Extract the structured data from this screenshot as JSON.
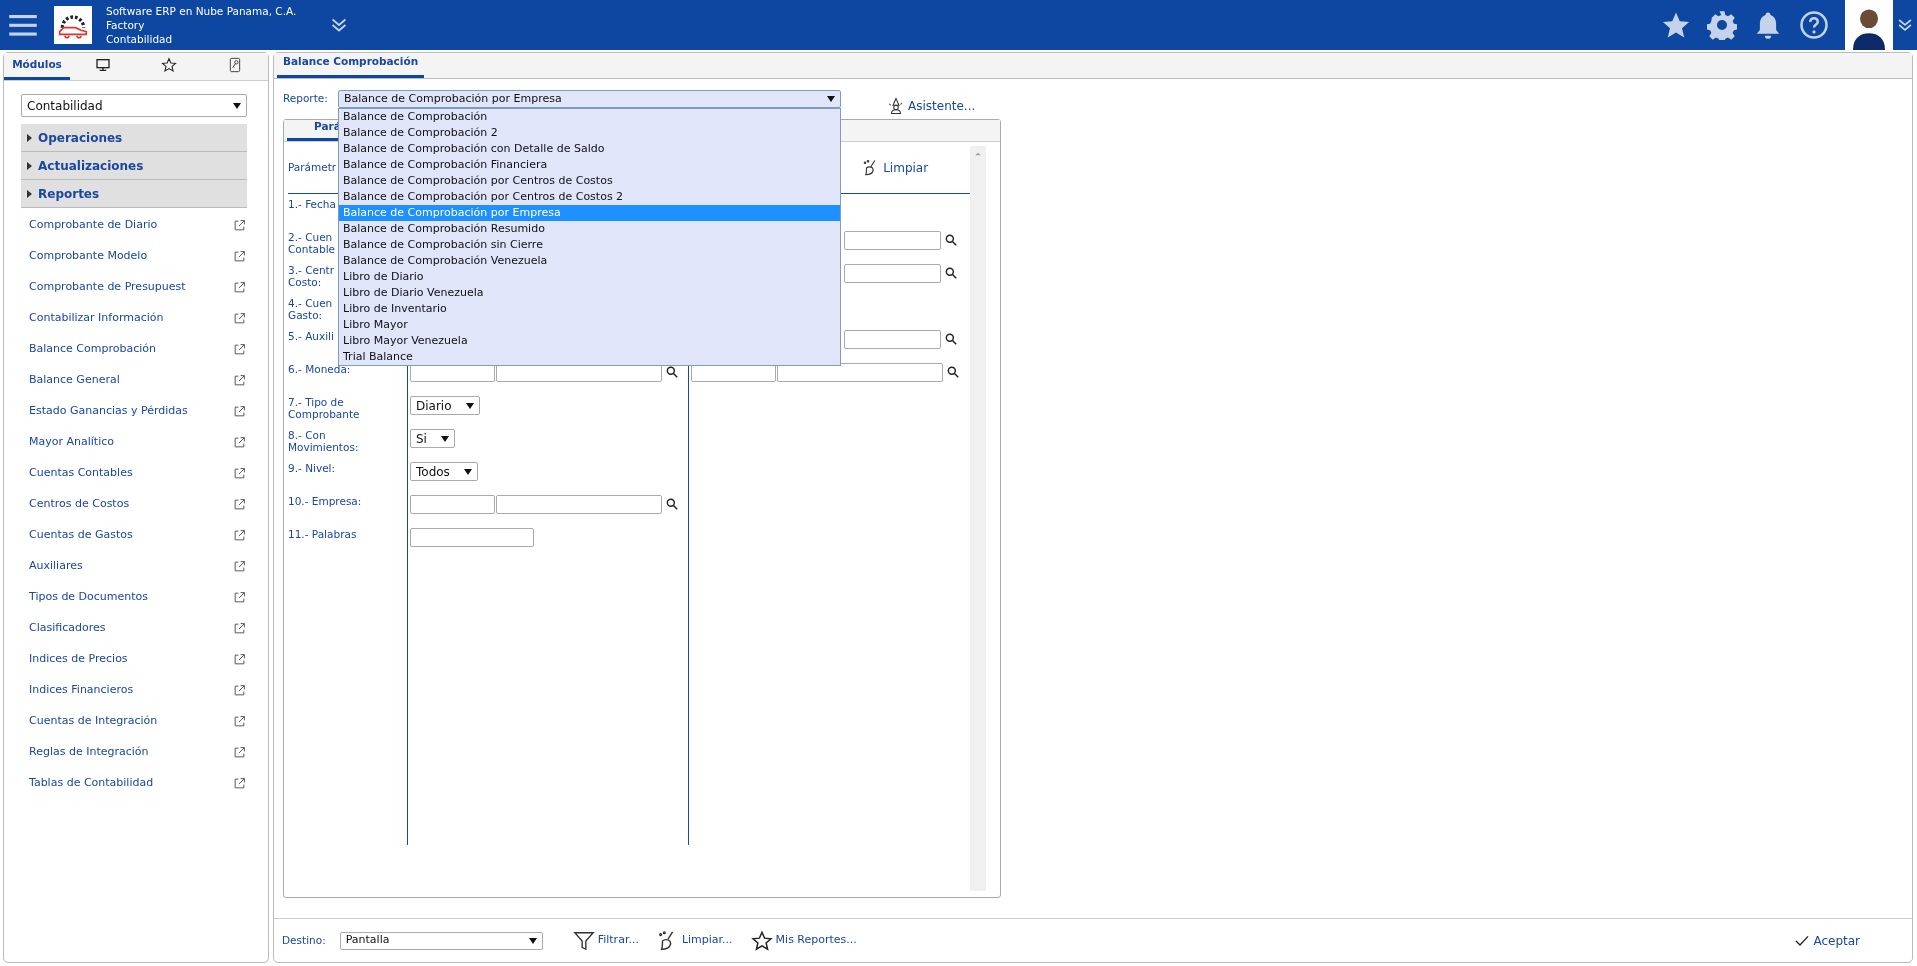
{
  "header": {
    "company": "Software ERP en Nube Panama, C.A.",
    "branch": "Factory",
    "module": "Contabilidad"
  },
  "sidebar": {
    "tabs": [
      {
        "kind": "text",
        "label": "Módulos",
        "selected": true
      },
      {
        "kind": "monitor",
        "selected": false
      },
      {
        "kind": "star",
        "selected": false
      },
      {
        "kind": "key",
        "selected": false
      }
    ],
    "module_select": "Contabilidad",
    "sections": [
      {
        "label": "Operaciones",
        "expanded": false
      },
      {
        "label": "Actualizaciones",
        "expanded": false
      },
      {
        "label": "Reportes",
        "expanded": false
      }
    ],
    "items": [
      "Comprobante de Diario",
      "Comprobante Modelo",
      "Comprobante de Presupuest",
      "Contabilizar Información",
      "Balance Comprobación",
      "Balance General",
      "Estado Ganancias y Pérdidas",
      "Mayor Analítico",
      "Cuentas Contables",
      "Centros de Costos",
      "Cuentas de Gastos",
      "Auxiliares",
      "Tipos de Documentos",
      "Clasificadores",
      "Indices de Precios",
      "Indices Financieros",
      "Cuentas de Integración",
      "Reglas de Integración",
      "Tablas de Contabilidad"
    ]
  },
  "main": {
    "tab": {
      "label": "Balance Comprobación",
      "selected": true
    },
    "report_label": "Reporte:",
    "report_value": "Balance de Comprobación por Empresa",
    "assistant": "Asistente...",
    "dropdown": {
      "open": true,
      "options": [
        {
          "label": "Balance de Comprobación",
          "selected": false
        },
        {
          "label": "Balance de Comprobación 2",
          "selected": false
        },
        {
          "label": "Balance de Comprobación con Detalle de Saldo",
          "selected": false
        },
        {
          "label": "Balance de Comprobación Financiera",
          "selected": false
        },
        {
          "label": "Balance de Comprobación por Centros de Costos",
          "selected": false
        },
        {
          "label": "Balance de Comprobación por Centros de Costos 2",
          "selected": false
        },
        {
          "label": "Balance de Comprobación por Empresa",
          "selected": true
        },
        {
          "label": "Balance de Comprobación Resumido",
          "selected": false
        },
        {
          "label": "Balance de Comprobación sin Cierre",
          "selected": false
        },
        {
          "label": "Balance de Comprobación Venezuela",
          "selected": false
        },
        {
          "label": "Libro de Diario",
          "selected": false
        },
        {
          "label": "Libro de Diario Venezuela",
          "selected": false
        },
        {
          "label": "Libro de Inventario",
          "selected": false
        },
        {
          "label": "Libro Mayor",
          "selected": false
        },
        {
          "label": "Libro Mayor Venezuela",
          "selected": false
        },
        {
          "label": "Trial Balance",
          "selected": false
        }
      ]
    },
    "inner_tab": "Pará",
    "params_heading": "Parámetr",
    "clear": "Limpiar",
    "rows": [
      {
        "label": "1.- Fecha"
      },
      {
        "label": "2.- Cuen\nContable",
        "col2": [
          {
            "kind": "lookup_tail"
          }
        ]
      },
      {
        "label": "3.- Centr\nCosto:",
        "col2": [
          {
            "kind": "lookup_tail"
          }
        ]
      },
      {
        "label": "4.- Cuen\nGasto:"
      },
      {
        "label": "5.- Auxili",
        "col2": [
          {
            "kind": "lookup_tail"
          }
        ]
      },
      {
        "label": "6.- Moneda:",
        "col1": [
          {
            "kind": "lookup"
          }
        ],
        "col2": [
          {
            "kind": "lookup"
          }
        ]
      },
      {
        "label": "7.- Tipo de\nComprobante",
        "col1": [
          {
            "kind": "select",
            "value": "Diario"
          }
        ]
      },
      {
        "label": "8.- Con\nMovimientos:",
        "col1": [
          {
            "kind": "select",
            "value": "Si"
          }
        ]
      },
      {
        "label": "9.- Nivel:",
        "col1": [
          {
            "kind": "select",
            "value": "Todos"
          }
        ]
      },
      {
        "label": "10.- Empresa:",
        "col1": [
          {
            "kind": "lookup"
          }
        ]
      },
      {
        "label": "11.- Palabras",
        "col1": [
          {
            "kind": "text"
          }
        ]
      }
    ]
  },
  "footer": {
    "destination_label": "Destino:",
    "destination": "Pantalla",
    "buttons": [
      {
        "kind": "filter",
        "label": "Filtrar..."
      },
      {
        "kind": "broom",
        "label": "Limpiar..."
      },
      {
        "kind": "star",
        "label": "Mis Reportes..."
      }
    ],
    "accept": "Aceptar"
  }
}
